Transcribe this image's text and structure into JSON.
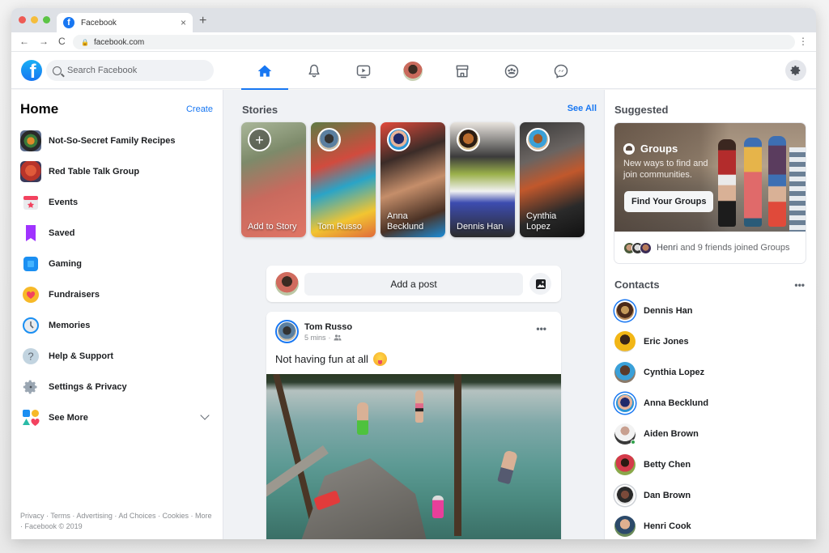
{
  "browser": {
    "tab_title": "Facebook",
    "tab_close": "×",
    "new_tab": "+",
    "url": "facebook.com",
    "back": "←",
    "forward": "→",
    "reload": "C",
    "menu": "⋮"
  },
  "header": {
    "logo_letter": "f",
    "search_placeholder": "Search Facebook",
    "nav_tabs": [
      {
        "name": "home",
        "icon": "home-icon",
        "active": true
      },
      {
        "name": "notifications",
        "icon": "bell-icon",
        "active": false
      },
      {
        "name": "watch",
        "icon": "video-icon",
        "active": false
      },
      {
        "name": "profile",
        "icon": "avatar",
        "active": false
      },
      {
        "name": "marketplace",
        "icon": "store-icon",
        "active": false
      },
      {
        "name": "groups",
        "icon": "groups-icon",
        "active": false
      },
      {
        "name": "messenger",
        "icon": "messenger-icon",
        "active": false
      }
    ],
    "settings_icon": "gear-icon"
  },
  "left_sidebar": {
    "title": "Home",
    "create_label": "Create",
    "items": [
      {
        "label": "Not-So-Secret Family Recipes",
        "icon": "group-recipes-icon"
      },
      {
        "label": "Red Table Talk Group",
        "icon": "group-redtable-icon"
      },
      {
        "label": "Events",
        "icon": "calendar-icon"
      },
      {
        "label": "Saved",
        "icon": "bookmark-icon"
      },
      {
        "label": "Gaming",
        "icon": "gaming-icon"
      },
      {
        "label": "Fundraisers",
        "icon": "heart-icon"
      },
      {
        "label": "Memories",
        "icon": "clock-icon"
      },
      {
        "label": "Help & Support",
        "icon": "help-icon"
      },
      {
        "label": "Settings & Privacy",
        "icon": "gear-icon"
      },
      {
        "label": "See More",
        "icon": "shapes-icon"
      }
    ],
    "footer": {
      "links": [
        "Privacy",
        "Terms",
        "Advertising",
        "Ad Choices",
        "Cookies",
        "More"
      ],
      "copyright": "Facebook © 2019",
      "separator": " · "
    }
  },
  "stories": {
    "title": "Stories",
    "see_all": "See All",
    "items": [
      {
        "label": "Add to Story",
        "type": "add"
      },
      {
        "label": "Tom Russo"
      },
      {
        "label": "Anna Becklund"
      },
      {
        "label": "Dennis Han"
      },
      {
        "label": "Cynthia Lopez"
      }
    ],
    "add_symbol": "+"
  },
  "composer": {
    "placeholder": "Add a post"
  },
  "post": {
    "author": "Tom Russo",
    "time": "5 mins",
    "time_separator": "·",
    "audience_icon": "friends-icon",
    "text": "Not having fun at all",
    "emoji": "winking-tongue-emoji",
    "more": "•••"
  },
  "right_sidebar": {
    "suggested_title": "Suggested",
    "suggested_card": {
      "title": "Groups",
      "description": "New ways to find and join communities.",
      "button": "Find Your Groups",
      "footer_name": "Henri",
      "footer_text": " and 9 friends joined Groups"
    },
    "contacts_title": "Contacts",
    "contacts_more": "•••",
    "contacts": [
      {
        "name": "Dennis Han",
        "ring": "blue",
        "online": false
      },
      {
        "name": "Eric Jones",
        "ring": "none",
        "online": false
      },
      {
        "name": "Cynthia Lopez",
        "ring": "none",
        "online": false
      },
      {
        "name": "Anna Becklund",
        "ring": "blue",
        "online": false
      },
      {
        "name": "Aiden Brown",
        "ring": "none",
        "online": true
      },
      {
        "name": "Betty Chen",
        "ring": "none",
        "online": false
      },
      {
        "name": "Dan Brown",
        "ring": "grey",
        "online": false
      },
      {
        "name": "Henri Cook",
        "ring": "none",
        "online": false
      }
    ]
  },
  "colors": {
    "brand_blue": "#1877f2",
    "feed_background": "#f0f2f5",
    "online_green": "#31a24c"
  }
}
